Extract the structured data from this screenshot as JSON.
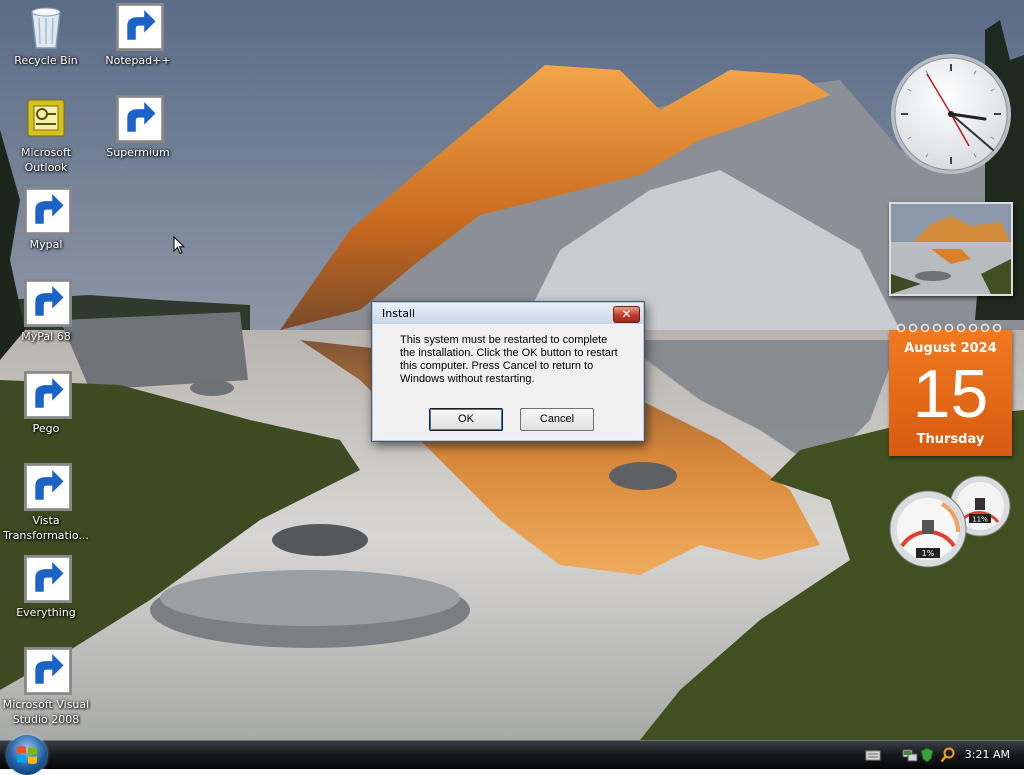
{
  "desktop": {
    "icons": [
      {
        "label": "Recycle Bin",
        "icon": "recycle-bin-icon",
        "shortcut": false
      },
      {
        "label": "Notepad++",
        "icon": "notepad-plus-plus-icon",
        "shortcut": true
      },
      {
        "label": "Microsoft Outlook",
        "icon": "outlook-icon",
        "shortcut": false
      },
      {
        "label": "Supermium",
        "icon": "supermium-icon",
        "shortcut": true
      },
      {
        "label": "Mypal",
        "icon": "mypal-icon",
        "shortcut": true
      },
      {
        "label": "MyPal 68",
        "icon": "mypal-68-icon",
        "shortcut": true
      },
      {
        "label": "Pego",
        "icon": "pego-icon",
        "shortcut": true
      },
      {
        "label": "Vista Transformatio...",
        "icon": "vista-transformation-icon",
        "shortcut": true
      },
      {
        "label": "Everything",
        "icon": "everything-icon",
        "shortcut": true
      },
      {
        "label": "Microsoft Visual Studio 2008",
        "icon": "visual-studio-icon",
        "shortcut": true
      }
    ]
  },
  "dialog": {
    "title": "Install",
    "close_glyph": "✕",
    "message": "This system must be restarted to complete the installation. Click the OK button to restart this computer. Press Cancel to return to Windows without restarting.",
    "ok_label": "OK",
    "cancel_label": "Cancel"
  },
  "gadgets": {
    "calendar": {
      "month_year": "August 2024",
      "day": "15",
      "weekday": "Thursday"
    },
    "cpu_meter": {
      "cpu": "1%",
      "memory": "11%"
    }
  },
  "taskbar": {
    "start_icon": "windows-logo-icon",
    "tray_icons": [
      "keyboard-icon",
      "network-icon",
      "security-icon",
      "search-icon"
    ],
    "time": "3:21 AM"
  },
  "colors": {
    "accent": "#e8701a",
    "taskbar": "#111417"
  }
}
